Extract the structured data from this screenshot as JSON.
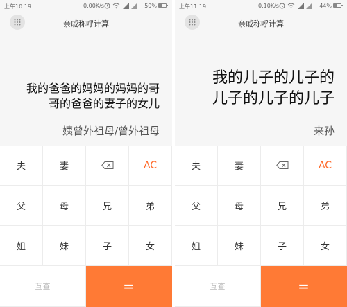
{
  "screens": [
    {
      "status": {
        "time": "上午10:19",
        "speed": "0.00K/s",
        "battery": "50%",
        "battery_level": 0.5
      },
      "title": "亲戚称呼计算",
      "expression_lines": [
        "我的爸爸的妈妈的妈妈的哥",
        "哥的爸爸的妻子的女儿"
      ],
      "result": "姨曾外祖母/曾外祖母",
      "keys": {
        "husband": "夫",
        "wife": "妻",
        "ac": "AC",
        "father": "父",
        "mother": "母",
        "elder_brother": "兄",
        "younger_brother": "弟",
        "elder_sister": "姐",
        "younger_sister": "妹",
        "son": "子",
        "daughter": "女",
        "swap": "互查",
        "equals": "="
      }
    },
    {
      "status": {
        "time": "上午11:19",
        "speed": "0.10K/s",
        "battery": "44%",
        "battery_level": 0.44
      },
      "title": "亲戚称呼计算",
      "expression_lines": [
        "我的儿子的儿子的",
        "儿子的儿子的儿子"
      ],
      "result": "来孙",
      "keys": {
        "husband": "夫",
        "wife": "妻",
        "ac": "AC",
        "father": "父",
        "mother": "母",
        "elder_brother": "兄",
        "younger_brother": "弟",
        "elder_sister": "姐",
        "younger_sister": "妹",
        "son": "子",
        "daughter": "女",
        "swap": "互查",
        "equals": "="
      }
    }
  ],
  "icons": [
    "grid-menu-icon",
    "backspace-icon",
    "alarm-icon",
    "wifi-icon",
    "signal-icon",
    "battery-icon"
  ],
  "colors": {
    "accent": "#ff7a35",
    "ac_text": "#ff6a2a",
    "background": "#f6f6f6"
  }
}
